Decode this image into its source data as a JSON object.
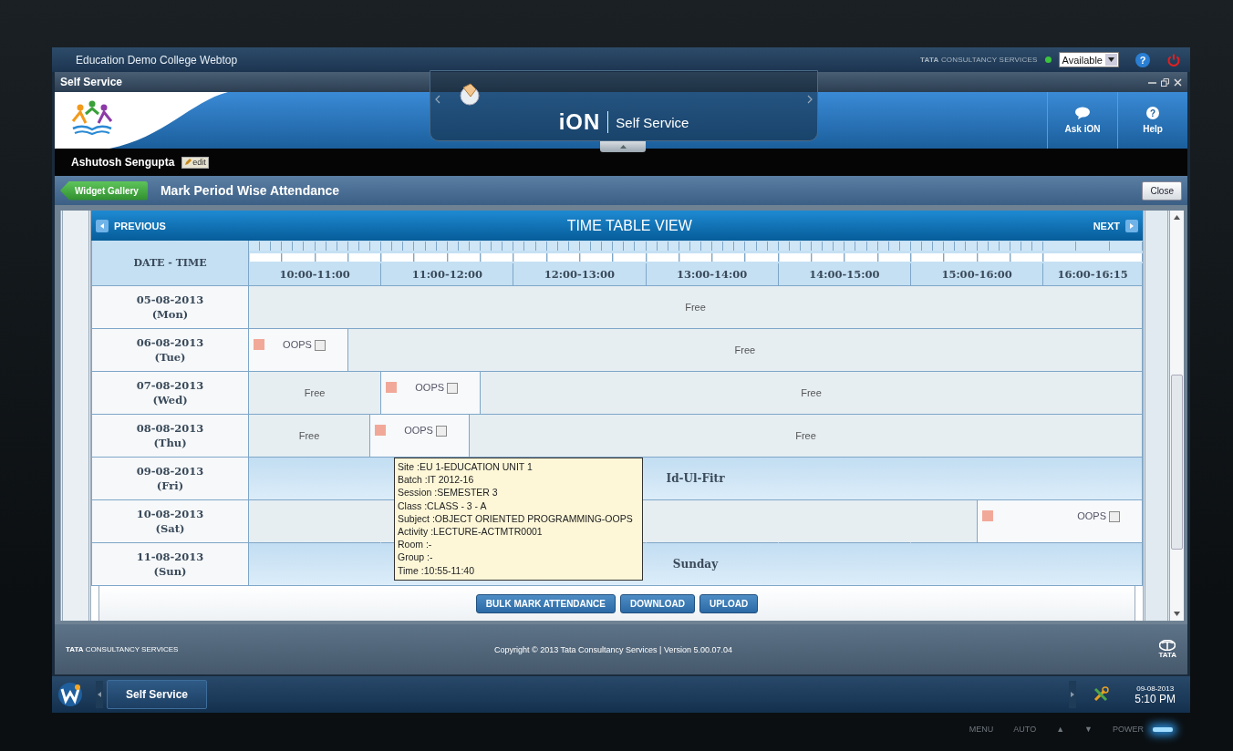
{
  "desktop": {
    "title": "Education Demo College Webtop",
    "vendor": "**TATA** CONSULTANCY SERVICES",
    "presence": {
      "status": "Available",
      "color": "#3cc43c"
    },
    "help": "?"
  },
  "window": {
    "title": "Self Service"
  },
  "banner": {
    "brand": "iON",
    "product": "Self Service",
    "actions": [
      {
        "label": "Ask iON",
        "kind": "chat"
      },
      {
        "label": "Help",
        "kind": "help",
        "glyph": "?"
      }
    ]
  },
  "user": {
    "name": "Ashutosh Sengupta",
    "edit": "edit"
  },
  "page": {
    "back": "Widget Gallery",
    "title": "Mark Period Wise Attendance",
    "close": "Close"
  },
  "timetable": {
    "previous": "PREVIOUS",
    "title": "TIME TABLE VIEW",
    "next": "NEXT",
    "corner": "DATE - TIME",
    "columns": [
      {
        "label": "10:00-11:00"
      },
      {
        "label": "11:00-12:00"
      },
      {
        "label": "12:00-13:00"
      },
      {
        "label": "13:00-14:00"
      },
      {
        "label": "14:00-15:00"
      },
      {
        "label": "15:00-16:00"
      },
      {
        "label": "16:00-16:15"
      }
    ],
    "rows": [
      {
        "date": "05-08-2013",
        "day": "(Mon)",
        "cells": [
          {
            "kind": "free",
            "label": "Free"
          }
        ]
      },
      {
        "date": "06-08-2013",
        "day": "(Tue)",
        "cells": [
          {
            "kind": "lecture",
            "label": "OOPS",
            "checked": false
          },
          {
            "kind": "free",
            "label": "Free"
          }
        ]
      },
      {
        "date": "07-08-2013",
        "day": "(Wed)",
        "cells": [
          {
            "kind": "free",
            "label": "Free"
          },
          {
            "kind": "lecture",
            "label": "OOPS",
            "checked": false
          },
          {
            "kind": "free",
            "label": "Free"
          }
        ]
      },
      {
        "date": "08-08-2013",
        "day": "(Thu)",
        "cells": [
          {
            "kind": "free",
            "label": "Free"
          },
          {
            "kind": "lecture",
            "label": "OOPS",
            "checked": false
          },
          {
            "kind": "free",
            "label": "Free"
          }
        ]
      },
      {
        "date": "09-08-2013",
        "day": "(Fri)",
        "cells": [
          {
            "kind": "holiday",
            "label": "Id-Ul-Fitr"
          }
        ]
      },
      {
        "date": "10-08-2013",
        "day": "(Sat)",
        "cells": [
          {
            "kind": "free"
          },
          {
            "kind": "free"
          },
          {
            "kind": "free"
          },
          {
            "kind": "free"
          },
          {
            "kind": "free"
          },
          {
            "kind": "free"
          },
          {
            "kind": "lecture",
            "label": "OOPS",
            "checked": false
          }
        ]
      },
      {
        "date": "11-08-2013",
        "day": "(Sun)",
        "cells": [
          {
            "kind": "holiday",
            "label": "Sunday"
          }
        ]
      }
    ],
    "actions": [
      "BULK MARK ATTENDANCE",
      "DOWNLOAD",
      "UPLOAD"
    ]
  },
  "tooltip": {
    "lines": [
      "Site :EU 1-EDUCATION UNIT 1",
      "Batch :IT 2012-16",
      "Session :SEMESTER 3",
      "Class :CLASS - 3 - A",
      "Subject :OBJECT ORIENTED PROGRAMMING-OOPS",
      "Activity :LECTURE-ACTMTR0001",
      "Room :-",
      "Group :-",
      "Time :10:55-11:40"
    ]
  },
  "footer": {
    "vendor": "**TATA** CONSULTANCY SERVICES",
    "copyright": "Copyright © 2013 Tata Consultancy Services | Version 5.00.07.04",
    "logo": "TATA"
  },
  "taskbar": {
    "task": "Self Service",
    "date": "09-08-2013",
    "time": "5:10 PM"
  },
  "monitor": {
    "buttons": [
      "MENU",
      "AUTO",
      "▲",
      "▼",
      "POWER"
    ]
  }
}
